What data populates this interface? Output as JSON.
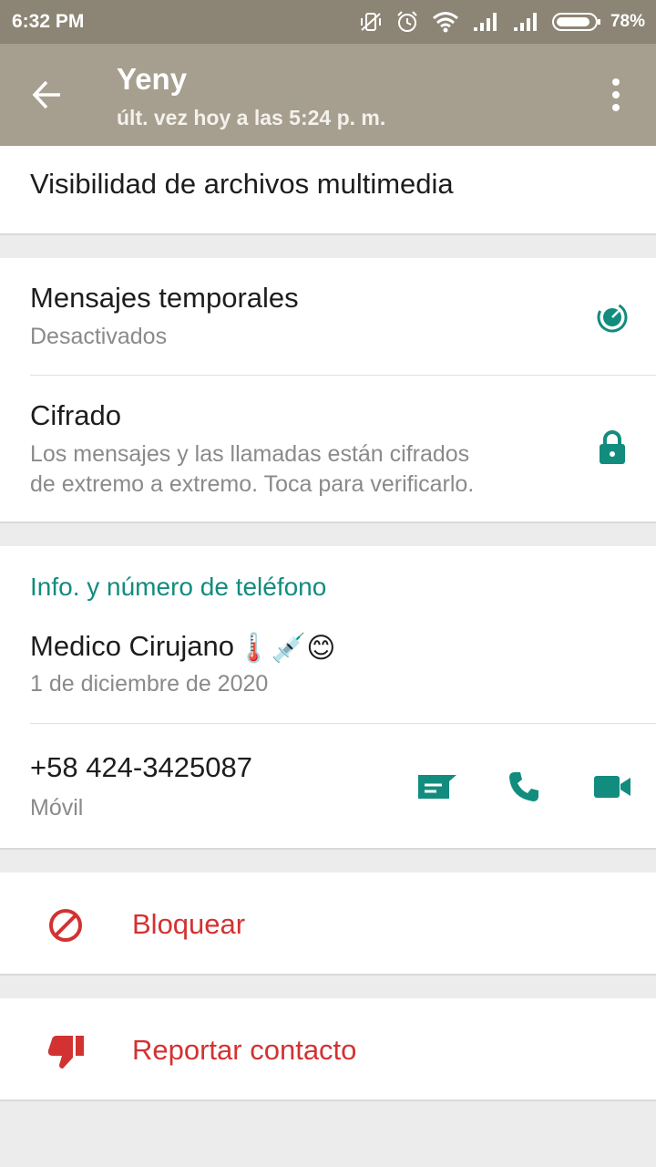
{
  "status_bar": {
    "time": "6:32 PM",
    "battery": "78%",
    "icons": [
      "vibrate-off-icon",
      "alarm-icon",
      "wifi-icon",
      "signal-icon",
      "signal-icon",
      "battery-icon"
    ]
  },
  "app_bar": {
    "title": "Yeny",
    "subtitle": "últ. vez hoy a las 5:24 p. m.",
    "back_icon": "arrow-back-icon",
    "menu_icon": "more-vert-icon"
  },
  "media": {
    "label": "Visibilidad de archivos multimedia"
  },
  "privacy": {
    "temp_title": "Mensajes temporales",
    "temp_sub": "Desactivados",
    "enc_title": "Cifrado",
    "enc_line1": "Los mensajes y las llamadas están cifrados",
    "enc_line2": "de extremo a extremo. Toca para verificarlo."
  },
  "info": {
    "section_title": "Info. y número de teléfono",
    "about": "Medico Cirujano",
    "about_emoji": "🌡️💉😊",
    "about_date": "1 de diciembre de 2020",
    "phone": "+58 424-3425087",
    "phone_type": "Móvil"
  },
  "actions": {
    "block": "Bloquear",
    "report": "Reportar contacto"
  },
  "colors": {
    "accent": "#128c7e",
    "danger": "#d23232",
    "appbar": "#a69f8f",
    "statusbar": "#8c8575"
  }
}
